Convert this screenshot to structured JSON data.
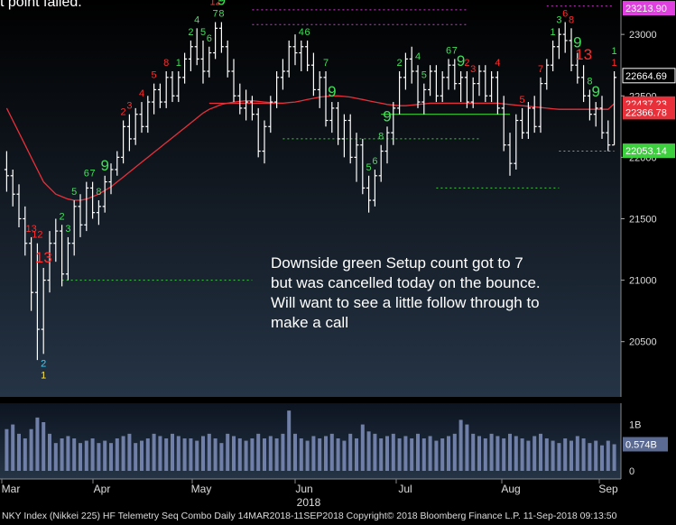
{
  "header": {
    "partial_title": "t point  failed."
  },
  "annotation": {
    "text": "Downside green Setup count got to 7 but was cancelled today on the bounce.  Will want to see a little follow through to make a call"
  },
  "footer": {
    "text": "NKY Index (Nikkei 225) HF Telemetry Seq Combo  Daily 14MAR2018-11SEP2018 Copyright© 2018 Bloomberg Finance L.P. 11-Sep-2018 09:13:50"
  },
  "colors": {
    "background": "#000000",
    "panel_top": "#1c2633",
    "bars": "#ffffff",
    "sma": "#e8303a",
    "sell_count": "#ff2d2d",
    "buy_count": "#41e05a",
    "volume": "#6f7fa8",
    "dotted_magenta": "#d43bd4",
    "dotted_green": "#3ecf3e"
  },
  "chart_data": {
    "type": "bar",
    "subtype": "ohlc",
    "series_label": "NKY Index",
    "y_axis_ticks": [
      20500,
      21000,
      21500,
      22000,
      22500,
      23000
    ],
    "ylim": [
      20050,
      23280
    ],
    "x_month_labels": [
      "Mar",
      "Apr",
      "May",
      "Jun",
      "Jul",
      "Aug",
      "Sep"
    ],
    "x_year_label": "2018",
    "price_labels": [
      {
        "text": "23213.90",
        "value": 23213.9,
        "color": "#e040e0"
      },
      {
        "text": "22664.69",
        "value": 22664.69,
        "color": "#ffffff"
      },
      {
        "text": "22437.23",
        "value": 22437.23,
        "color": "#e8303a"
      },
      {
        "text": "22366.78",
        "value": 22366.78,
        "color": "#e8303a"
      },
      {
        "text": "22053.14",
        "value": 22053.14,
        "color": "#3ecf3e"
      }
    ],
    "ohlc": [
      [
        21900,
        22050,
        21720,
        21850
      ],
      [
        21850,
        21900,
        21600,
        21700
      ],
      [
        21700,
        21780,
        21430,
        21500
      ],
      [
        21500,
        21600,
        21200,
        21300
      ],
      [
        21300,
        21350,
        20750,
        20900
      ],
      [
        20900,
        21300,
        20350,
        20600
      ],
      [
        20600,
        21100,
        20400,
        21000
      ],
      [
        21000,
        21400,
        20900,
        21300
      ],
      [
        21300,
        21500,
        21150,
        21400
      ],
      [
        21400,
        21450,
        20950,
        21050
      ],
      [
        21050,
        21350,
        21000,
        21300
      ],
      [
        21300,
        21650,
        21200,
        21600
      ],
      [
        21600,
        21700,
        21350,
        21450
      ],
      [
        21450,
        21800,
        21400,
        21750
      ],
      [
        21750,
        21800,
        21500,
        21550
      ],
      [
        21550,
        21650,
        21450,
        21600
      ],
      [
        21600,
        21850,
        21550,
        21800
      ],
      [
        21800,
        21950,
        21700,
        21900
      ],
      [
        21900,
        22050,
        21850,
        22000
      ],
      [
        22000,
        22300,
        21950,
        22250
      ],
      [
        22250,
        22350,
        22050,
        22150
      ],
      [
        22150,
        22400,
        22100,
        22350
      ],
      [
        22350,
        22450,
        22200,
        22250
      ],
      [
        22250,
        22500,
        22200,
        22450
      ],
      [
        22450,
        22600,
        22350,
        22550
      ],
      [
        22550,
        22600,
        22400,
        22450
      ],
      [
        22450,
        22700,
        22400,
        22650
      ],
      [
        22650,
        22700,
        22450,
        22500
      ],
      [
        22500,
        22700,
        22450,
        22650
      ],
      [
        22650,
        22850,
        22600,
        22800
      ],
      [
        22800,
        22950,
        22700,
        22900
      ],
      [
        22900,
        23050,
        22750,
        22800
      ],
      [
        22800,
        22950,
        22600,
        22700
      ],
      [
        22700,
        22900,
        22650,
        22850
      ],
      [
        22850,
        23100,
        22800,
        23050
      ],
      [
        23050,
        23100,
        22850,
        22900
      ],
      [
        22900,
        22950,
        22650,
        22700
      ],
      [
        22700,
        22800,
        22450,
        22500
      ],
      [
        22500,
        22600,
        22350,
        22400
      ],
      [
        22400,
        22550,
        22300,
        22450
      ],
      [
        22450,
        22500,
        22300,
        22350
      ],
      [
        22350,
        22400,
        22000,
        22050
      ],
      [
        22050,
        22300,
        21950,
        22250
      ],
      [
        22250,
        22500,
        22200,
        22450
      ],
      [
        22450,
        22700,
        22400,
        22650
      ],
      [
        22650,
        22800,
        22550,
        22700
      ],
      [
        22700,
        22950,
        22650,
        22900
      ],
      [
        22900,
        23000,
        22750,
        22850
      ],
      [
        22850,
        22950,
        22700,
        22900
      ],
      [
        22900,
        22950,
        22700,
        22750
      ],
      [
        22750,
        22850,
        22500,
        22550
      ],
      [
        22550,
        22700,
        22400,
        22650
      ],
      [
        22650,
        22700,
        22250,
        22300
      ],
      [
        22300,
        22450,
        22200,
        22400
      ],
      [
        22400,
        22450,
        22100,
        22150
      ],
      [
        22150,
        22350,
        22000,
        22300
      ],
      [
        22300,
        22350,
        21950,
        22000
      ],
      [
        22000,
        22200,
        21800,
        22100
      ],
      [
        22100,
        22150,
        21700,
        21750
      ],
      [
        21750,
        21850,
        21550,
        21650
      ],
      [
        21650,
        21900,
        21600,
        21850
      ],
      [
        21850,
        22100,
        21800,
        22050
      ],
      [
        22050,
        22250,
        21950,
        22200
      ],
      [
        22200,
        22450,
        22100,
        22400
      ],
      [
        22400,
        22700,
        22350,
        22650
      ],
      [
        22650,
        22850,
        22550,
        22800
      ],
      [
        22800,
        22900,
        22600,
        22700
      ],
      [
        22700,
        22750,
        22400,
        22450
      ],
      [
        22450,
        22600,
        22350,
        22550
      ],
      [
        22550,
        22750,
        22500,
        22700
      ],
      [
        22700,
        22750,
        22450,
        22500
      ],
      [
        22500,
        22700,
        22450,
        22650
      ],
      [
        22650,
        22800,
        22550,
        22750
      ],
      [
        22750,
        22800,
        22550,
        22600
      ],
      [
        22600,
        22700,
        22450,
        22650
      ],
      [
        22650,
        22700,
        22400,
        22450
      ],
      [
        22450,
        22650,
        22400,
        22600
      ],
      [
        22600,
        22750,
        22500,
        22700
      ],
      [
        22700,
        22750,
        22450,
        22500
      ],
      [
        22500,
        22700,
        22450,
        22650
      ],
      [
        22650,
        22700,
        22350,
        22400
      ],
      [
        22400,
        22500,
        22050,
        22100
      ],
      [
        22100,
        22200,
        21850,
        21950
      ],
      [
        21950,
        22350,
        21900,
        22300
      ],
      [
        22300,
        22400,
        22150,
        22200
      ],
      [
        22200,
        22450,
        22150,
        22400
      ],
      [
        22400,
        22500,
        22200,
        22250
      ],
      [
        22250,
        22650,
        22200,
        22600
      ],
      [
        22600,
        22800,
        22550,
        22750
      ],
      [
        22750,
        22950,
        22700,
        22900
      ],
      [
        22900,
        23050,
        22800,
        23000
      ],
      [
        23000,
        23100,
        22850,
        22950
      ],
      [
        22950,
        23050,
        22700,
        22750
      ],
      [
        22750,
        22850,
        22600,
        22650
      ],
      [
        22650,
        22750,
        22450,
        22500
      ],
      [
        22500,
        22550,
        22300,
        22350
      ],
      [
        22350,
        22450,
        22250,
        22400
      ],
      [
        22400,
        22500,
        22150,
        22200
      ],
      [
        22200,
        22300,
        22050,
        22100
      ],
      [
        22100,
        22700,
        22100,
        22650
      ]
    ],
    "sma_values": [
      22400,
      22300,
      22200,
      22100,
      22000,
      21900,
      21800,
      21750,
      21700,
      21680,
      21660,
      21650,
      21650,
      21660,
      21680,
      21700,
      21730,
      21760,
      21800,
      21840,
      21880,
      21920,
      21960,
      22000,
      22040,
      22080,
      22120,
      22160,
      22200,
      22240,
      22280,
      22320,
      22360,
      22390,
      22410,
      22430,
      22440,
      22450,
      22455,
      22460,
      22460,
      22455,
      22450,
      22445,
      22440,
      22440,
      22445,
      22450,
      22460,
      22470,
      22480,
      22490,
      22495,
      22500,
      22500,
      22495,
      22490,
      22480,
      22470,
      22460,
      22450,
      22440,
      22430,
      22425,
      22420,
      22420,
      22425,
      22430,
      22435,
      22440,
      22440,
      22440,
      22440,
      22440,
      22440,
      22440,
      22440,
      22440,
      22440,
      22440,
      22440,
      22435,
      22430,
      22425,
      22420,
      22415,
      22410,
      22405,
      22400,
      22395,
      22390,
      22390,
      22390,
      22390,
      22390,
      22390,
      22390,
      22390,
      22390,
      22437
    ],
    "dotted_levels": [
      {
        "value": 23080,
        "from": 40,
        "to": 75,
        "color": "magenta"
      },
      {
        "value": 23200,
        "from": 40,
        "to": 75,
        "color": "magenta"
      },
      {
        "value": 23230,
        "from": 88,
        "to": 100,
        "color": "magenta"
      },
      {
        "value": 21000,
        "from": 9,
        "to": 40,
        "color": "green"
      },
      {
        "value": 22150,
        "from": 45,
        "to": 77,
        "color": "green"
      },
      {
        "value": 21750,
        "from": 70,
        "to": 90,
        "color": "green"
      },
      {
        "value": 22050,
        "from": 90,
        "to": 100,
        "color": "green"
      }
    ],
    "solid_levels": [
      {
        "value": 22350,
        "from": 61,
        "to": 82,
        "color": "green"
      },
      {
        "value": 22440,
        "from": 33,
        "to": 45,
        "color": "red"
      }
    ],
    "counts": [
      {
        "bar": 4,
        "text": "13",
        "color": "sell"
      },
      {
        "bar": 5,
        "text": "12",
        "color": "sell"
      },
      {
        "bar": 6,
        "text": "13",
        "color": "sell",
        "big": true
      },
      {
        "bar": 6,
        "text": "2",
        "color": "cyan",
        "below": true
      },
      {
        "bar": 6,
        "text": "1",
        "color": "yellow",
        "below": true
      },
      {
        "bar": 9,
        "text": "2",
        "color": "buy"
      },
      {
        "bar": 10,
        "text": "3",
        "color": "buy"
      },
      {
        "bar": 11,
        "text": "5",
        "color": "buy"
      },
      {
        "bar": 13,
        "text": "6",
        "color": "buy"
      },
      {
        "bar": 14,
        "text": "7",
        "color": "buy"
      },
      {
        "bar": 15,
        "text": "8",
        "color": "buy"
      },
      {
        "bar": 16,
        "text": "9",
        "color": "buy",
        "big": true
      },
      {
        "bar": 19,
        "text": "2",
        "color": "sell"
      },
      {
        "bar": 20,
        "text": "3",
        "color": "sell"
      },
      {
        "bar": 22,
        "text": "4",
        "color": "sell"
      },
      {
        "bar": 24,
        "text": "5",
        "color": "sell"
      },
      {
        "bar": 26,
        "text": "8",
        "color": "sell"
      },
      {
        "bar": 28,
        "text": "1",
        "color": "buy"
      },
      {
        "bar": 30,
        "text": "2",
        "color": "buy"
      },
      {
        "bar": 31,
        "text": "4",
        "color": "buy"
      },
      {
        "bar": 32,
        "text": "5",
        "color": "buy"
      },
      {
        "bar": 33,
        "text": "6",
        "color": "buy"
      },
      {
        "bar": 34,
        "text": "7",
        "color": "buy"
      },
      {
        "bar": 35,
        "text": "8",
        "color": "buy"
      },
      {
        "bar": 35,
        "text": "9",
        "color": "buy",
        "big": true
      },
      {
        "bar": 35,
        "text": "13",
        "color": "sell",
        "big": true
      },
      {
        "bar": 34,
        "text": "12",
        "color": "sell"
      },
      {
        "bar": 48,
        "text": "4",
        "color": "buy"
      },
      {
        "bar": 49,
        "text": "6",
        "color": "buy"
      },
      {
        "bar": 52,
        "text": "7",
        "color": "buy"
      },
      {
        "bar": 53,
        "text": "9",
        "color": "buy",
        "big": true
      },
      {
        "bar": 59,
        "text": "5",
        "color": "buy"
      },
      {
        "bar": 60,
        "text": "6",
        "color": "buy"
      },
      {
        "bar": 61,
        "text": "8",
        "color": "buy"
      },
      {
        "bar": 62,
        "text": "9",
        "color": "buy",
        "big": true
      },
      {
        "bar": 64,
        "text": "2",
        "color": "buy"
      },
      {
        "bar": 67,
        "text": "4",
        "color": "buy"
      },
      {
        "bar": 68,
        "text": "5",
        "color": "buy"
      },
      {
        "bar": 73,
        "text": "7",
        "color": "buy"
      },
      {
        "bar": 74,
        "text": "9",
        "color": "buy",
        "big": true
      },
      {
        "bar": 72,
        "text": "6",
        "color": "buy"
      },
      {
        "bar": 75,
        "text": "2",
        "color": "sell"
      },
      {
        "bar": 76,
        "text": "3",
        "color": "sell"
      },
      {
        "bar": 80,
        "text": "4",
        "color": "sell"
      },
      {
        "bar": 84,
        "text": "5",
        "color": "sell"
      },
      {
        "bar": 87,
        "text": "7",
        "color": "sell"
      },
      {
        "bar": 89,
        "text": "1",
        "color": "buy"
      },
      {
        "bar": 90,
        "text": "3",
        "color": "buy"
      },
      {
        "bar": 91,
        "text": "6",
        "color": "sell"
      },
      {
        "bar": 92,
        "text": "8",
        "color": "sell"
      },
      {
        "bar": 93,
        "text": "9",
        "color": "buy",
        "big": true
      },
      {
        "bar": 94,
        "text": "13",
        "color": "sell",
        "big": true
      },
      {
        "bar": 95,
        "text": "8",
        "color": "buy"
      },
      {
        "bar": 96,
        "text": "9",
        "color": "buy",
        "big": true
      },
      {
        "bar": 99,
        "text": "1",
        "color": "sell"
      },
      {
        "bar": 99,
        "text": "1",
        "color": "buy"
      }
    ],
    "volume": {
      "ticks": [
        {
          "text": "1B",
          "value": 1.0
        },
        {
          "text": "0",
          "value": 0
        }
      ],
      "last_label": "0.574B",
      "last_value": 0.574,
      "values": [
        0.9,
        1.0,
        0.8,
        0.7,
        0.9,
        1.15,
        1.05,
        0.8,
        0.6,
        0.7,
        0.75,
        0.7,
        0.6,
        0.65,
        0.7,
        0.6,
        0.65,
        0.6,
        0.7,
        0.75,
        0.8,
        0.6,
        0.65,
        0.7,
        0.8,
        0.75,
        0.7,
        0.8,
        0.75,
        0.7,
        0.7,
        0.65,
        0.75,
        0.8,
        0.7,
        0.6,
        0.8,
        0.75,
        0.7,
        0.65,
        0.7,
        0.8,
        0.7,
        0.75,
        0.7,
        0.8,
        1.3,
        0.8,
        0.7,
        0.65,
        0.75,
        0.7,
        0.75,
        0.8,
        0.7,
        0.65,
        0.8,
        0.7,
        1.0,
        0.85,
        0.8,
        0.7,
        0.75,
        0.8,
        0.7,
        0.75,
        0.7,
        0.8,
        0.7,
        0.75,
        0.65,
        0.7,
        0.75,
        0.8,
        1.1,
        1.0,
        0.8,
        0.75,
        0.7,
        0.8,
        0.75,
        0.7,
        0.8,
        0.75,
        0.7,
        0.65,
        0.75,
        0.8,
        0.7,
        0.65,
        0.6,
        0.7,
        0.65,
        0.75,
        0.7,
        0.6,
        0.65,
        0.55,
        0.65,
        0.574
      ]
    }
  }
}
